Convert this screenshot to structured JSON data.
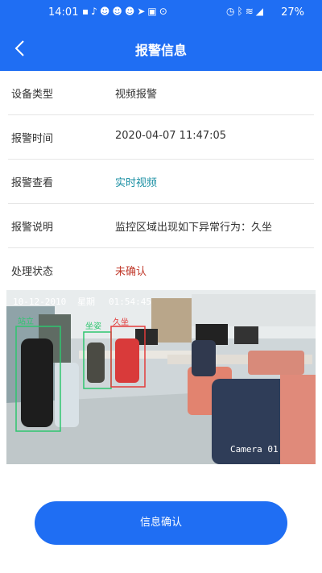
{
  "status_bar": {
    "time": "14:01",
    "battery": "27%",
    "left_icons": [
      "message-icon",
      "tiktok-icon",
      "avatar-icon",
      "avatar-icon",
      "avatar-icon",
      "telegram-icon",
      "image-icon",
      "location-icon"
    ],
    "right_icons": [
      "alarm-icon",
      "bluetooth-icon",
      "wifi-icon",
      "signal-icon"
    ]
  },
  "header": {
    "title": "报警信息"
  },
  "details": [
    {
      "label": "设备类型",
      "value": "视频报警"
    },
    {
      "label": "报警时间",
      "value": "2020-04-07 11:47:05"
    },
    {
      "label": "报警查看",
      "value": "实时视频"
    },
    {
      "label": "报警说明",
      "value": "监控区域出现如下异常行为：久坐"
    },
    {
      "label": "处理状态",
      "value": "未确认"
    }
  ],
  "video": {
    "timestamp_date": "10-12-2010",
    "timestamp_weekday": "星期",
    "timestamp_time": "01:54:45",
    "camera_label": "Camera 01",
    "detection_label_1": "站立",
    "detection_label_2": "久坐",
    "detection_label_3": "坐姿"
  },
  "actions": {
    "confirm_label": "信息确认"
  },
  "colors": {
    "primary": "#1f6ef3",
    "link": "#1a8fa3",
    "warning": "#c0392b"
  }
}
